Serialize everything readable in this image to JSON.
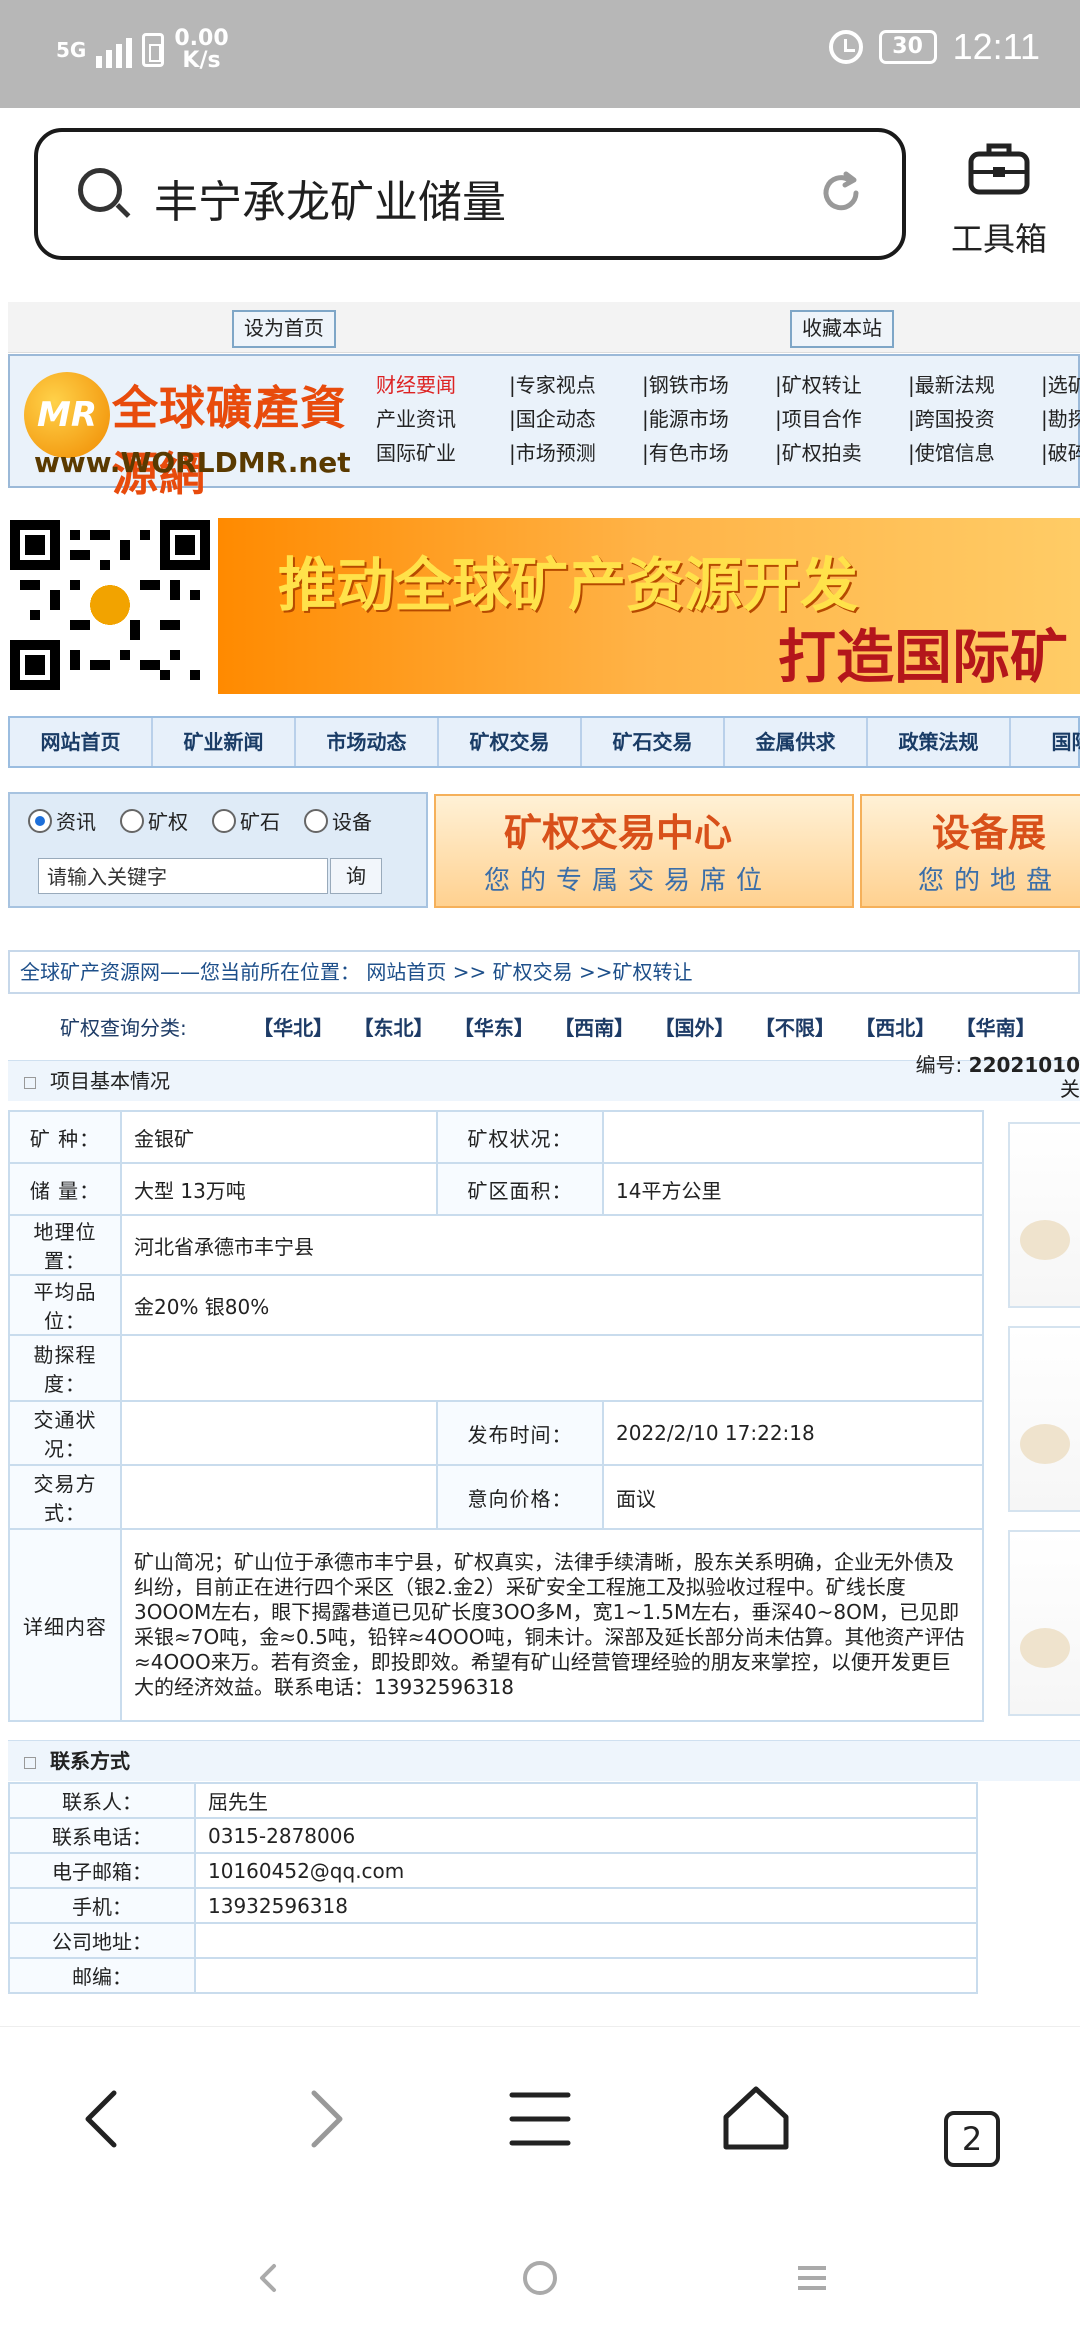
{
  "status_bar": {
    "signal_label": "5G",
    "net_speed_value": "0.00",
    "net_speed_unit": "K/s",
    "battery": "30",
    "time": "12:11"
  },
  "search": {
    "query": "丰宁承龙矿业储量",
    "toolbox_label": "工具箱"
  },
  "site": {
    "top_buttons": [
      "设为首页",
      "收藏本站"
    ],
    "logo_cn": "全球礦產資源網",
    "logo_en": "www.WORLDMR.net",
    "logo_mark": "MR",
    "nav_rows": [
      [
        "财经要闻",
        "|专家视点",
        "|钢铁市场",
        "|矿权转让",
        "|最新法规",
        "|选矿"
      ],
      [
        "产业资讯",
        "|国企动态",
        "|能源市场",
        "|项目合作",
        "|跨国投资",
        "|勘探"
      ],
      [
        "国际矿业",
        "|市场预测",
        "|有色市场",
        "|矿权拍卖",
        "|使馆信息",
        "|破碎"
      ]
    ],
    "banner_line1": "推动全球矿产资源开发",
    "banner_line2": "打造国际矿",
    "main_nav": [
      "网站首页",
      "矿业新闻",
      "市场动态",
      "矿权交易",
      "矿石交易",
      "金属供求",
      "政策法规",
      "国际合"
    ],
    "search_radios": [
      "资讯",
      "矿权",
      "矿石",
      "设备"
    ],
    "keyword_placeholder": "请输入关键字",
    "search_button": "询",
    "ad1_title": "矿权交易中心",
    "ad1_sub": "您的专属交易席位",
    "ad2_title": "设备展",
    "ad2_sub": "您的地盘",
    "breadcrumb": "全球矿产资源网——您当前所在位置： 网站首页 >> 矿权交易 >>矿权转让",
    "category_label": "矿权查询分类:",
    "categories": [
      "【华北】",
      "【东北】",
      "【华东】",
      "【西南】",
      "【国外】",
      "【不限】",
      "【西北】",
      "【华南】"
    ],
    "section1_title": "项目基本情况",
    "serial_label": "编号:",
    "serial_value": "22021010",
    "serial_suffix": "关",
    "info": {
      "mineral_label": "矿  种：",
      "mineral": "金银矿",
      "status_label": "矿权状况：",
      "status": "",
      "reserve_label": "储  量：",
      "reserve": "大型 13万吨",
      "area_label": "矿区面积：",
      "area": "14平方公里",
      "location_label": "地理位置：",
      "location": "河北省承德市丰宁县",
      "grade_label": "平均品位：",
      "grade": "金20% 银80%",
      "explore_label": "勘探程度：",
      "explore": "",
      "traffic_label": "交通状况：",
      "traffic": "",
      "publish_label": "发布时间：",
      "publish": "2022/2/10 17:22:18",
      "trade_label": "交易方式：",
      "trade": "",
      "price_label": "意向价格：",
      "price": "面议",
      "detail_label": "详细内容",
      "detail": "矿山简况；矿山位于承德市丰宁县，矿权真实，法律手续清晰，股东关系明确，企业无外债及纠纷，目前正在进行四个采区（银2.金2）采矿安全工程施工及拟验收过程中。矿线长度3OOOM左右，眼下揭露巷道已见矿长度3OO多M，宽1~1.5M左右，垂深40~8OM，已见即采银≈7O吨，金≈0.5吨，铅锌≈4OOO吨，铜未计。深部及延长部分尚未估算。其他资产评估≈4OOO来万。若有资金，即投即效。希望有矿山经营管理经验的朋友来掌控，以便开发更巨大的经济效益。联系电话：13932596318"
    },
    "section2_title": "联系方式",
    "contact": {
      "person_label": "联系人：",
      "person": "屈先生",
      "phone_label": "联系电话：",
      "phone": "0315-2878006",
      "email_label": "电子邮箱：",
      "email": "10160452@qq.com",
      "mobile_label": "手机：",
      "mobile": "13932596318",
      "address_label": "公司地址：",
      "address": "",
      "zip_label": "邮编：",
      "zip": ""
    }
  },
  "browser_bar": {
    "tab_count": "2"
  },
  "icons": [
    "search-icon",
    "refresh-icon",
    "toolbox-icon",
    "back-icon",
    "forward-icon",
    "menu-icon",
    "home-icon",
    "tabs-icon"
  ],
  "colors": {
    "status_bg": "#b7b7b7",
    "link_blue": "#1d4f8a",
    "hot_red": "#d22222",
    "banner_orange": "#ff8a00"
  }
}
